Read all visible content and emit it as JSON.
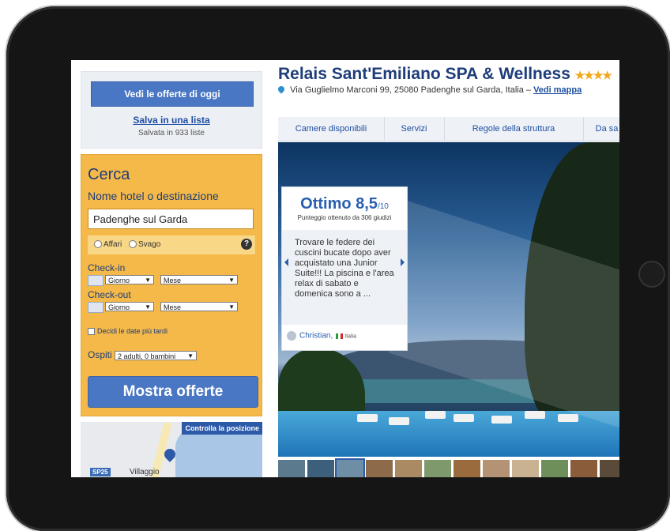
{
  "sidebar": {
    "deals_button": "Vedi le offerte di oggi",
    "save_link": "Salva in una lista",
    "saved_count": "Salvata in 933 liste"
  },
  "search": {
    "title": "Cerca",
    "destination_label": "Nome hotel o destinazione",
    "destination_value": "Padenghe sul Garda",
    "purpose_options": [
      "Affari",
      "Svago"
    ],
    "help_icon": "?",
    "checkin_label": "Check-in",
    "checkout_label": "Check-out",
    "day_select": "Giorno",
    "month_select": "Mese",
    "decide_later": "Decidi le date più tardi",
    "guests_label": "Ospiti",
    "guests_value": "2 adulti, 0 bambini",
    "submit": "Mostra offerte"
  },
  "map": {
    "check_position": "Controlla la posizione",
    "road_badge": "SP25",
    "place": "Villaggio"
  },
  "hotel": {
    "name": "Relais Sant'Emiliano SPA & Wellness",
    "stars": "★★★★",
    "address": "Via Guglielmo Marconi 99, 25080 Padenghe sul Garda, Italia –",
    "map_link": "Vedi mappa"
  },
  "tabs": [
    "Camere disponibili",
    "Servizi",
    "Regole della struttura",
    "Da sa"
  ],
  "review": {
    "score_label": "Ottimo 8,5",
    "score_max": "/10",
    "score_sub": "Punteggio ottenuto da 306 giudizi",
    "quote": "Trovare le federe dei cuscini bucate dopo aver acquistato una Junior Suite!!! La piscina e l'area relax di sabato e domenica sono a ...",
    "reviewer": "Christian,",
    "country": "Italia"
  },
  "colors": {
    "brand_blue": "#1f3d7a",
    "button_blue": "#4a77c4",
    "search_yellow": "#f4b949",
    "score_blue": "#2a5fb0",
    "star_gold": "#f2a91d"
  }
}
